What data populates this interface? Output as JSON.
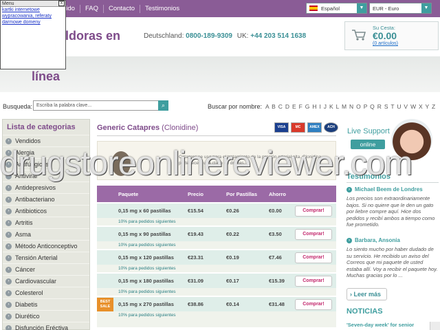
{
  "menu_popup": {
    "title": "Menu",
    "close": "x",
    "links": [
      "kartki internetowe",
      "wypracowania, referaty",
      "darmowe domeny"
    ]
  },
  "topnav": {
    "items": [
      "dido",
      "FAQ",
      "Contacto",
      "Testimonios"
    ]
  },
  "language_select": {
    "value": "Español"
  },
  "currency_select": {
    "value": "EUR - Euro"
  },
  "header": {
    "title_part1": "íldoras en",
    "title_part2": "línea",
    "phone_label_de": "Deutschland:",
    "phone_de": "0800-189-9309",
    "phone_label_uk": "UK:",
    "phone_uk": "+44 203 514 1638"
  },
  "cart": {
    "label": "Su Cesta:",
    "amount": "€0.00",
    "items": "(0 artículos)"
  },
  "search": {
    "label": "Busqueda:",
    "placeholder": "Escriba la palabra clave...",
    "alpha_label": "Buscar por nombre:",
    "letters": "A B C D E F G H I J K L M N O P Q R S T U V W X Y Z"
  },
  "sidebar": {
    "title": "Lista de categorias",
    "items": [
      "Vendidos",
      "Alergia",
      "Antifúngicos",
      "Antiviral",
      "Antidepresivos",
      "Antibacteriano",
      "Antibioticos",
      "Artritis",
      "Asma",
      "Método Anticonceptivo",
      "Tensión Arterial",
      "Cáncer",
      "Cardiovascular",
      "Colesterol",
      "Diabetis",
      "Diurético",
      "Disfunción Eréctiva"
    ]
  },
  "product": {
    "title": "Generic Catapres",
    "subtitle": "(Clonidine)",
    "cards": [
      "VISA",
      "MC",
      "AMEX",
      "ACH"
    ],
    "description": "Catapres se usa para el tratamiento de la presión arterial alta. Clonidina pertenece a una clase de drogas."
  },
  "table": {
    "headers": [
      "Paquete",
      "Precio",
      "Por Pastillas",
      "Ahorro"
    ],
    "rows": [
      {
        "pkg": "0,15 mg x 60 pastillas",
        "price": "€15.54",
        "per": "€0.26",
        "save": "€0.00",
        "note": "10% para pedidos siguientes",
        "best": ""
      },
      {
        "pkg": "0,15 mg x 90 pastillas",
        "price": "€19.43",
        "per": "€0.22",
        "save": "€3.50",
        "note": "10% para pedidos siguientes",
        "best": ""
      },
      {
        "pkg": "0,15 mg x 120 pastillas",
        "price": "€23.31",
        "per": "€0.19",
        "save": "€7.46",
        "note": "10% para pedidos siguientes",
        "best": ""
      },
      {
        "pkg": "0,15 mg x 180 pastillas",
        "price": "€31.09",
        "per": "€0.17",
        "save": "€15.39",
        "note": "10% para pedidos siguientes",
        "best": ""
      },
      {
        "pkg": "0,15 mg x 270 pastillas",
        "price": "€38.86",
        "per": "€0.14",
        "save": "€31.48",
        "note": "10% para pedidos siguientes",
        "best": "BEST SALE"
      }
    ],
    "buy_label": "Comprar!"
  },
  "support": {
    "title": "Live Support",
    "status": "online"
  },
  "testimonials": {
    "title": "Testimonios",
    "items": [
      {
        "name": "Michael Beem de Londres",
        "text": "Los precios son extraordinariamente bajos. Si no quiere que le den un gato por liebre compre aquí. Hice dos pedidos y recibí ambos a tiempo como fue prometido."
      },
      {
        "name": "Barbara, Ansonia",
        "text": "Lo siento mucho por haber dudado de su servicio. He recibido un aviso del Correos que mi paquete de usted estaba allí. Voy a recibir el paquete hoy. Muchas gracias por lo ..."
      }
    ],
    "more": "Leer más"
  },
  "news": {
    "title": "NOTICIAS",
    "item": "'Seven-day week' for senior"
  },
  "watermark": "drugstoreonlinereviewer.com",
  "colors": {
    "brand_purple": "#8a5c96",
    "accent_teal": "#3f9e9f",
    "buy_pink": "#c2276c",
    "best_sale_orange": "#e8902a"
  }
}
